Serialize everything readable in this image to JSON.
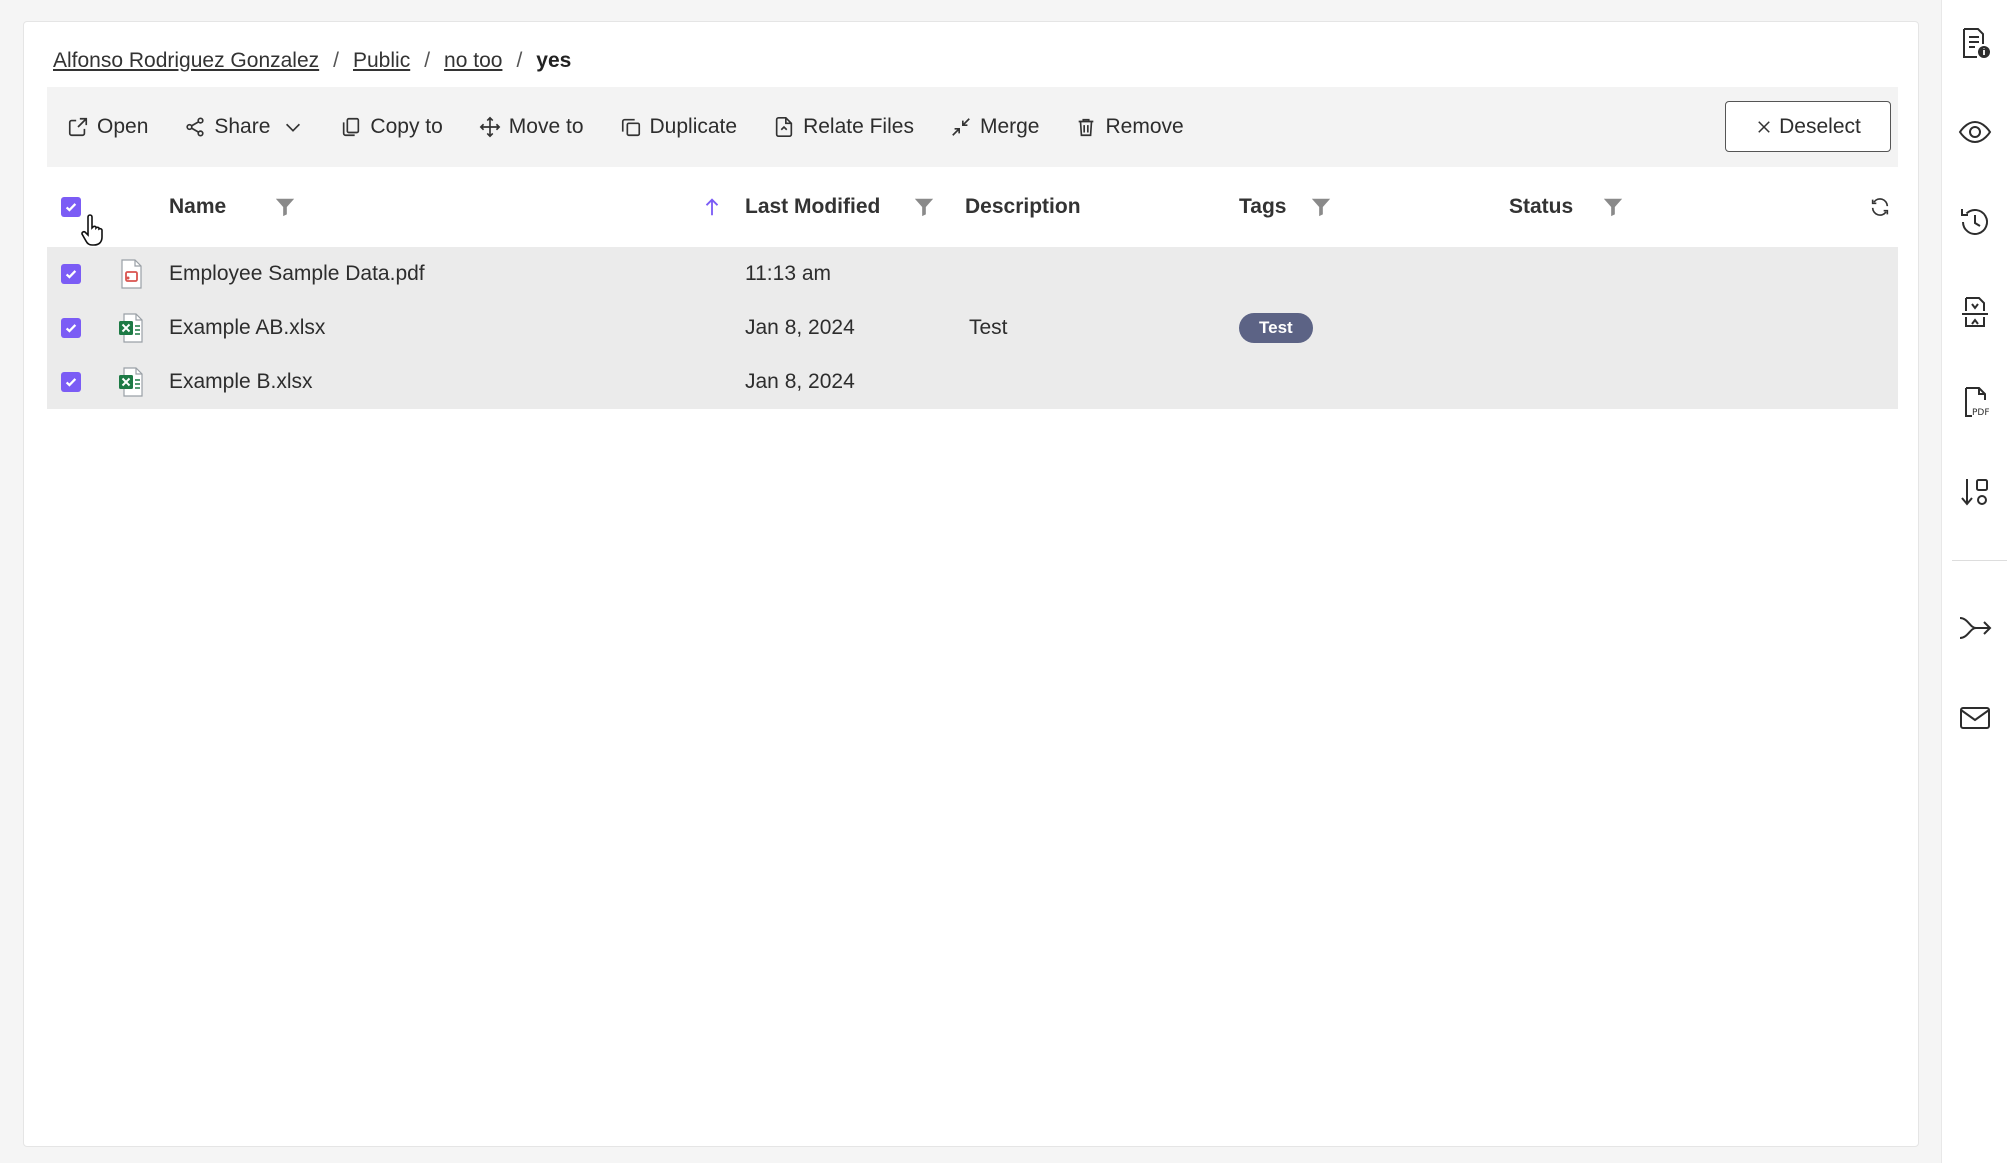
{
  "breadcrumb": {
    "items": [
      "Alfonso Rodriguez Gonzalez",
      "Public",
      "no too"
    ],
    "current": "yes",
    "separator": "/"
  },
  "toolbar": {
    "open": "Open",
    "share": "Share",
    "copy_to": "Copy to",
    "move_to": "Move to",
    "duplicate": "Duplicate",
    "relate_files": "Relate Files",
    "merge": "Merge",
    "remove": "Remove",
    "deselect": "Deselect"
  },
  "table": {
    "columns": {
      "name": "Name",
      "last_modified": "Last Modified",
      "description": "Description",
      "tags": "Tags",
      "status": "Status"
    },
    "sort": {
      "column": "name",
      "direction": "ascending"
    },
    "rows": [
      {
        "name": "Employee Sample Data.pdf",
        "type": "pdf-file-icon",
        "last_modified": "11:13 am",
        "description": "",
        "tag": "",
        "status": "",
        "checked": true
      },
      {
        "name": "Example AB.xlsx",
        "type": "excel-file-icon",
        "last_modified": "Jan 8, 2024",
        "description": "Test",
        "tag": "Test",
        "status": "",
        "checked": true
      },
      {
        "name": "Example B.xlsx",
        "type": "excel-file-icon",
        "last_modified": "Jan 8, 2024",
        "description": "",
        "tag": "",
        "status": "",
        "checked": true
      }
    ],
    "select_all_checked": true
  },
  "right_rail": {
    "icons": [
      "file-info-icon",
      "eye-icon",
      "history-icon",
      "compress-file-icon",
      "pdf-file-icon",
      "sort-shapes-icon",
      "workflow-arrow-icon",
      "mail-icon"
    ]
  },
  "colors": {
    "accent": "#7b5cf5",
    "tag_bg": "#5c6385",
    "selected_row_bg": "#ebebeb",
    "pdf_red": "#d9534f",
    "excel_green": "#1d7a45"
  }
}
